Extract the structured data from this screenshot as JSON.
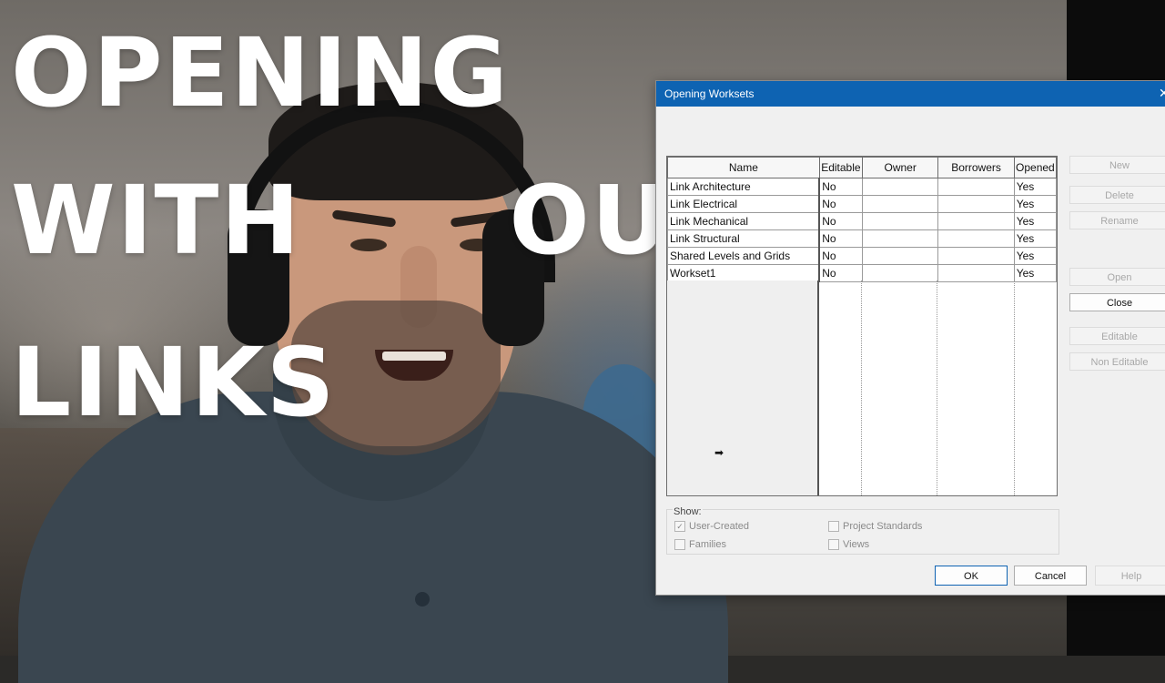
{
  "overlay": {
    "line1": "OPENING",
    "line2": "WITH",
    "line2_tail": "OU",
    "line3": "LINKS"
  },
  "dialog": {
    "title": "Opening Worksets",
    "close_glyph": "✕",
    "columns": [
      "Name",
      "Editable",
      "Owner",
      "Borrowers",
      "Opened"
    ],
    "rows": [
      {
        "name": "Link Architecture",
        "editable": "No",
        "owner": "",
        "borrowers": "",
        "opened": "Yes"
      },
      {
        "name": "Link Electrical",
        "editable": "No",
        "owner": "",
        "borrowers": "",
        "opened": "Yes"
      },
      {
        "name": "Link Mechanical",
        "editable": "No",
        "owner": "",
        "borrowers": "",
        "opened": "Yes"
      },
      {
        "name": "Link Structural",
        "editable": "No",
        "owner": "",
        "borrowers": "",
        "opened": "Yes"
      },
      {
        "name": "Shared Levels and Grids",
        "editable": "No",
        "owner": "",
        "borrowers": "",
        "opened": "Yes"
      },
      {
        "name": "Workset1",
        "editable": "No",
        "owner": "",
        "borrowers": "",
        "opened": "Yes"
      }
    ],
    "cursor_glyph": "➡",
    "side_buttons": {
      "new": "New",
      "delete": "Delete",
      "rename": "Rename",
      "open": "Open",
      "close": "Close",
      "editable": "Editable",
      "non_editable": "Non Editable"
    },
    "show": {
      "label": "Show:",
      "user_created": "User-Created",
      "families": "Families",
      "project_standards": "Project Standards",
      "views": "Views",
      "check_glyph": "✓"
    },
    "buttons": {
      "ok": "OK",
      "cancel": "Cancel",
      "help": "Help"
    }
  },
  "colors": {
    "titlebar": "#0e63b2",
    "dialog_bg": "#f0f0f0",
    "overlay_text": "#ffffff"
  }
}
